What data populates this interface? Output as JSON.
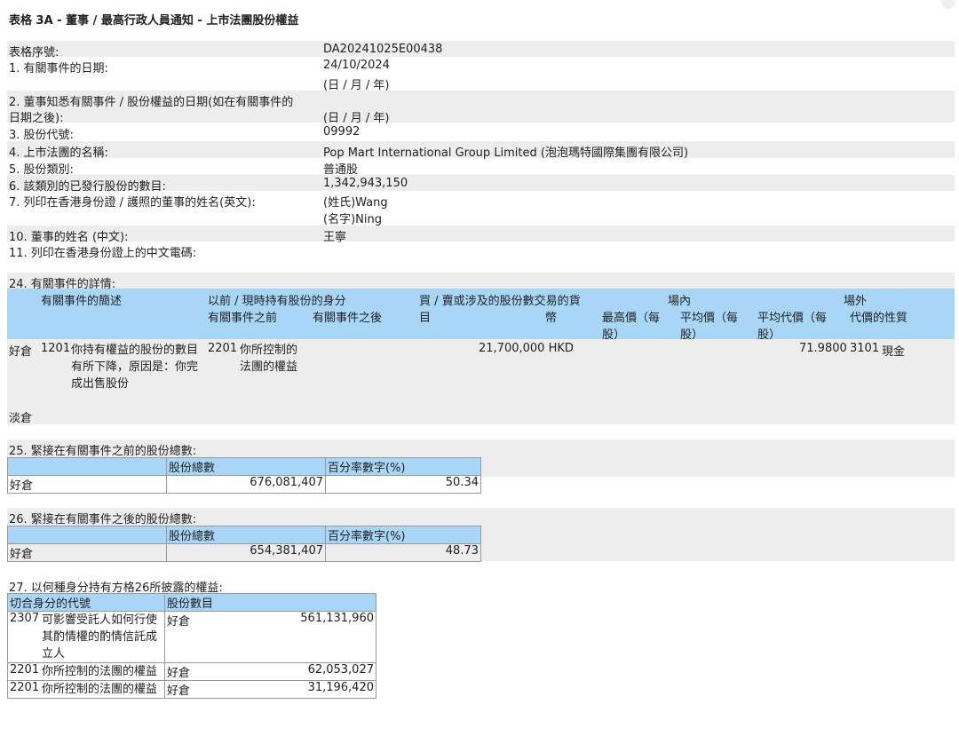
{
  "title": "表格 3A - 董事 / 最高行政人員通知 - 上市法團股份權益",
  "fields": [
    {
      "label": "表格序號:",
      "value": "DA20241025E00438"
    },
    {
      "label": "1. 有關事件的日期:",
      "value": "24/10/2024",
      "value2": "(日 / 月 / 年)"
    },
    {
      "label": "2. 董事知悉有關事件 / 股份權益的日期(如在有關事件的",
      "label2": "日期之後):",
      "value": "(日 / 月 / 年)"
    },
    {
      "label": "3. 股份代號:",
      "value": "09992"
    },
    {
      "label": "4. 上市法團的名稱:",
      "value": "Pop Mart International Group Limited (泡泡瑪特國際集團有限公司)"
    },
    {
      "label": "5. 股份類別:",
      "value": "普通股"
    },
    {
      "label": "6. 該類別的已發行股份的數目:",
      "value": "1,342,943,150"
    },
    {
      "label": "7. 列印在香港身份證 / 護照的董事的姓名(英文):",
      "value": "(姓氏)Wang",
      "value2": "(名字)Ning"
    },
    {
      "label": "10. 董事的姓名 (中文):",
      "value": "王寧"
    },
    {
      "label": "11. 列印在香港身份證上的中文電碼:",
      "value": ""
    }
  ],
  "s24": {
    "heading": "24. 有關事件的詳情:",
    "h_desc": "有關事件的簡述",
    "h_capacity": "以前 / 現時持有股份的身分",
    "h_before": "有關事件之前",
    "h_after": "有關事件之後",
    "h_shares": "買 / 賣或涉及的股份數交易的貨",
    "h_shares2": "目",
    "h_currency": "幣",
    "h_onex": "場內",
    "h_offex": "場外",
    "h_high": "最高價（每",
    "h_high2": "股）",
    "h_avg": "平均價（每",
    "h_avg2": "股）",
    "h_avg_off": "平均代價（每",
    "h_avg_off2": "股）",
    "h_nature": "代價的性質",
    "long_label": "好倉",
    "code": "1201",
    "desc": "你持有權益的股份的數目有所下降，原因是：你完成出售股份",
    "cap_code": "2201",
    "cap_text": "你所控制的法團的權益",
    "shares": "21,700,000 HKD",
    "avg_price": "71.9800",
    "nature_code": "3101",
    "nature": "現金",
    "short_label": "淡倉"
  },
  "s25": {
    "heading": "25. 緊接在有關事件之前的股份總數:",
    "col1": "股份總數",
    "col2": "百分率數字(%)",
    "row_label": "好倉",
    "total": "676,081,407",
    "pct": "50.34"
  },
  "s26": {
    "heading": "26. 緊接在有關事件之後的股份總數:",
    "col1": "股份總數",
    "col2": "百分率數字(%)",
    "row_label": "好倉",
    "total": "654,381,407",
    "pct": "48.73"
  },
  "s27": {
    "heading": "27. 以何種身分持有方格26所披露的權益:",
    "col1": "切合身分的代號",
    "col2": "股份數目",
    "rows": [
      {
        "code": "2307",
        "text": "可影響受託人如何行使其酌情權的酌情信託成立人",
        "pos": "好倉",
        "num": "561,131,960"
      },
      {
        "code": "2201",
        "text": "你所控制的法團的權益",
        "pos": "好倉",
        "num": "62,053,027"
      },
      {
        "code": "2201",
        "text": "你所控制的法團的權益",
        "pos": "好倉",
        "num": "31,196,420"
      }
    ]
  }
}
